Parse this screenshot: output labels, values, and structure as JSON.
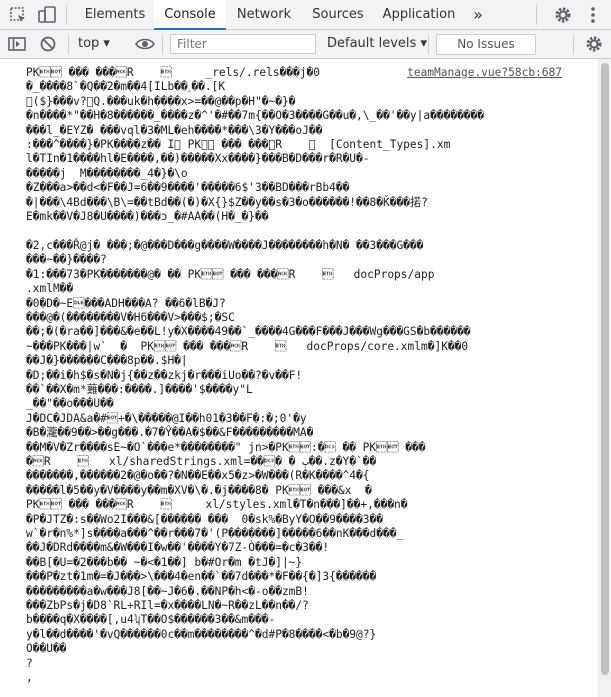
{
  "tabs": [
    {
      "label": "Elements"
    },
    {
      "label": "Console"
    },
    {
      "label": "Network"
    },
    {
      "label": "Sources"
    },
    {
      "label": "Application"
    }
  ],
  "more_tabs_label": "»",
  "toolbar": {
    "context": "top ▾",
    "filter_placeholder": "Filter",
    "levels": "Default levels ▾",
    "issues": "No Issues"
  },
  "console": {
    "source_link": "teamManage.vue?58cb:687",
    "text": "PK\u0003\u0004 ��� ���\u0006R    \u0003     _rels/.rels���j�0 \n�_����8`�Q��2�m��4[ILb��˰��.[K\n\u0000($}���v?\u0000Q.���uk�h����x>=��@��p�H\"�~�}�\n�n����*\"��H�8������_����z�^'�#��7m{��O�3����G��u�,\\_��'��y|a��������\n���l_�EYZ� ���vql�3�ML�eh����*���\\3�Y���oJ��\n:���^����}�PK����z�� I\u0000 PK\u0003\u0004 ��� ���\u0006R    \u0003  [Content_Types].xm\nl�TIn�1����hl�E����,��)�����Xx����}���B�D���r�R�U�-\n�����j  M��������_4�}�\\o\n�Z���a>��d<�F��J=6��9����'�����6$'3��BD���rBb4��\n�|���\\4Bd���\\B\\=��tBd��(�)�X{}$Z��y��s�3�o������!��8�Ǩ���掿?\nE�mk��V�J8�U����)���ɔ_�#AA��(H�_�}��\n\n�2,c���Ř@j� ���;�@���D���g����W����J��������h�N� ��3���G���\n���~��}����?\n�1:���73�PK�������@� �� PK\u0003\u0004 ��� ���\u0006R    \u0003   docProps/app\n.xmlM��\n�0�D�~E\u0010���ADH���A? ��6�lB�J?\n���@�(��������V�H6���V>���$;�SC\n��;�(�ra��]���&�e��L!y�X����49��`_����4G���F���J���Wg���GS�b������\n~���PK���|w`  �  PK\u0003\u0004 ��� ���\u0006R    \u0003   docProps/core.xmlm�]K��0\n��J�}������C���8p��.$H�|\n�D;��i�h$�s�N�j{��z��zkj�r���iUo��?�v��F!\n��`��X�m*䕼���:����.]����'$����y\"L\n_��\"��o���U��\nJ�DC�JDA&a�#\u0004+�\\�����@I��h01�3��F�:�;0'�y\n�B�瀧��9��>��g���.�7�Ŷ��A�$��&F���������MA�\n��M�V�Zr����sE~�O`���e*��������\" jn>�PK\u0003\u0004:�\u0013 �� PK\u0003\u0004 ���\n�\u0006R    \u0003   xl/sharedStrings.xml=��\u0013� � ٻ��.z�Y�`��\n�������,������2�@�o��?�N��E��x5�z>�W���(R�K����^4�{\n�����l�5��y�V����y��m�XV�\\�.�j����8� PK\u0003\u0004 ���&x  �\nPK\u0003\u0004 ��� ���\u0006R    \u0003     xl/styles.xml�T�n���]��+,���n�\n�P�JTZ�:s��Wo2I���&[������ ���  0�sk%�ByY�O��9����3��\nw`�r�n%*]s����a���^��r���7�'(P�������]�����6��nK���d���_\n��J�DRd����m&�W���I�w��'����Y�7Z-Ò���=�c�3��!\n��B[�U=�2���b�� ~�<�1��] b�#Or�m �tJ�]|~}\n���P�zt�1m�=�J���>\\���4�en��`��7d���*�F��{�]3{������\n���������a�w���J8[��~J�6�.��NP�h<�-o��zmB!\n���ZbPs�j�D8`RL+RIl=�x����LN�~R��zL��n��/?\nb����q�X����[,u4ʮT��O$������3��&m���-\ny�l��d����'�vQ������0c��m��������^�d#P�8����<�b�9@?}\nO��U��\n?\n,"
  }
}
